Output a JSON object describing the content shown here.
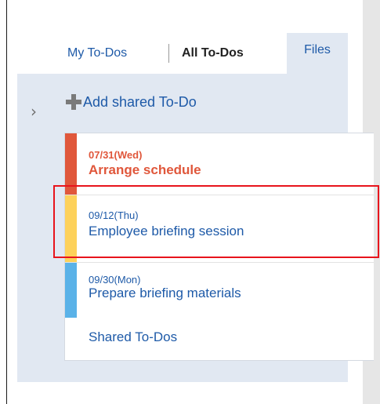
{
  "tabs": {
    "my_todos": "My To-Dos",
    "all_todos": "All To-Dos",
    "files": "Files"
  },
  "add_button": {
    "label": "Add shared To-Do",
    "icon": "plus-icon"
  },
  "collapse_icon": {
    "glyph": "›",
    "icon": "chevron-right-icon"
  },
  "todos": [
    {
      "date": "07/31(Wed)",
      "title": "Arrange schedule",
      "color": "#e0573b",
      "overdue": true
    },
    {
      "date": "09/12(Thu)",
      "title": "Employee briefing session",
      "color": "#fdd15a",
      "overdue": false
    },
    {
      "date": "09/30(Mon)",
      "title": "Prepare briefing materials",
      "color": "#5ab2e8",
      "overdue": false
    }
  ],
  "shared_link": "Shared To-Dos",
  "colors": {
    "link": "#1e5aa8",
    "panel_bg": "#e1e8f2",
    "highlight": "#e8141c"
  }
}
